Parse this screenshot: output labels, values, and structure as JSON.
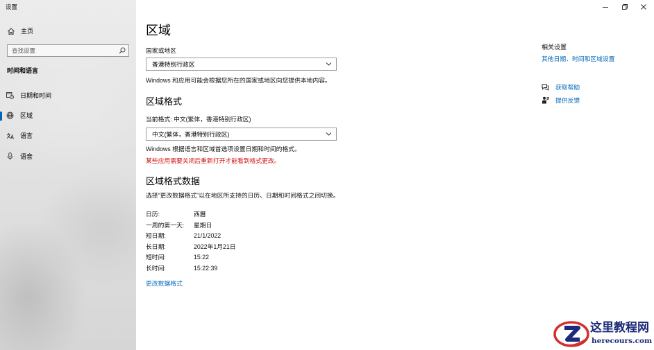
{
  "window": {
    "title": "设置",
    "controls": [
      "minimize-icon",
      "restore-icon",
      "close-icon"
    ]
  },
  "sidebar": {
    "home_label": "主页",
    "home_icon": "home-icon",
    "search_placeholder": "查找设置",
    "search_icon": "search-icon",
    "section_title": "时间和语言",
    "items": [
      {
        "label": "日期和时间",
        "icon": "calendar-clock-icon",
        "selected": false
      },
      {
        "label": "区域",
        "icon": "globe-icon",
        "selected": true
      },
      {
        "label": "语言",
        "icon": "language-icon",
        "selected": false
      },
      {
        "label": "语音",
        "icon": "microphone-icon",
        "selected": false
      }
    ]
  },
  "main": {
    "title": "区域",
    "country_label": "国家或地区",
    "country_value": "香港特别行政区",
    "country_note": "Windows 和应用可能会根据您所在的国家或地区向您提供本地内容。",
    "format_heading": "区域格式",
    "current_format": "当前格式: 中文(繁体，香港特别行政区)",
    "format_value": "中文(繁体，香港特别行政区)",
    "format_note": "Windows 根据语言和区域首选项设置日期和时间的格式。",
    "format_warning": "某些应用需要关闭后重新打开才能看到格式更改。",
    "data_heading": "区域格式数据",
    "data_note": "选择“更改数据格式”以在地区所支持的日历、日期和时间格式之间切换。",
    "rows": [
      {
        "label": "日历:",
        "value": "西曆"
      },
      {
        "label": "一周的第一天:",
        "value": "星期日"
      },
      {
        "label": "短日期:",
        "value": "21/1/2022"
      },
      {
        "label": "长日期:",
        "value": "2022年1月21日"
      },
      {
        "label": "短时间:",
        "value": "15:22"
      },
      {
        "label": "长时间:",
        "value": "15:22:39"
      }
    ],
    "change_link": "更改数据格式"
  },
  "related": {
    "title": "相关设置",
    "link": "其他日期、时间和区域设置",
    "help_label": "获取帮助",
    "help_icon": "chat-help-icon",
    "feedback_label": "提供反馈",
    "feedback_icon": "feedback-icon"
  },
  "watermark": {
    "title": "这里教程网",
    "url": "herecours.com"
  },
  "colors": {
    "accent": "#0067b8",
    "warning": "#d00f0f",
    "watermark": "#1c2a78",
    "watermark_ring": "#d32f2f"
  }
}
